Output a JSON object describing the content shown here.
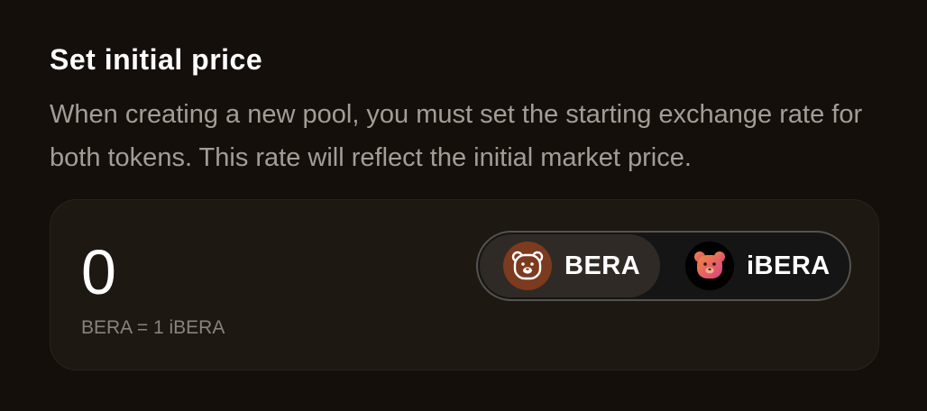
{
  "section": {
    "title": "Set initial price",
    "description": "When creating a new pool, you must set the starting exchange rate for both tokens. This rate will reflect the initial market price."
  },
  "price": {
    "value": "0",
    "rate_label": "BERA = 1 iBERA"
  },
  "token_toggle": {
    "selected": "BERA",
    "options": [
      {
        "label": "BERA",
        "icon": "bera-bear-icon",
        "active": true
      },
      {
        "label": "iBERA",
        "icon": "ibera-bear-icon",
        "active": false
      }
    ]
  },
  "colors": {
    "background": "#140f0b",
    "card": "#1d1812",
    "text_primary": "#ffffff",
    "text_secondary": "#a39d96",
    "bera_logo": "#7c3a1e"
  }
}
